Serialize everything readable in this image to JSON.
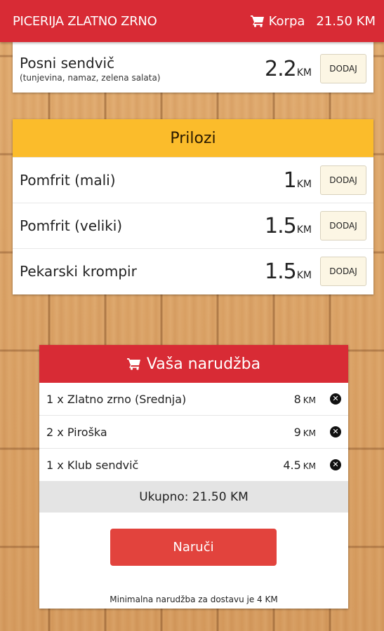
{
  "header": {
    "brand": "PICERIJA ZLATNO ZRNO",
    "cart_icon": "cart-icon",
    "cart_label": "Korpa",
    "cart_total": "21.50 KM",
    "color": "#d82b35"
  },
  "partial_item": {
    "name": "Posni sendvič",
    "description": "(tunjevina, namaz, zelena salata)",
    "price": "2.2",
    "currency": "KM",
    "add_label": "DODAJ"
  },
  "prilozi": {
    "title": "Prilozi",
    "color": "#fbbc2b",
    "items": [
      {
        "name": "Pomfrit (mali)",
        "price": "1",
        "currency": "KM",
        "add_label": "DODAJ"
      },
      {
        "name": "Pomfrit (veliki)",
        "price": "1.5",
        "currency": "KM",
        "add_label": "DODAJ"
      },
      {
        "name": "Pekarski krompir",
        "price": "1.5",
        "currency": "KM",
        "add_label": "DODAJ"
      }
    ]
  },
  "order": {
    "title": "Vaša narudžba",
    "cart_icon": "cart-icon",
    "items": [
      {
        "text": "1 x Zlatno zrno (Srednja)",
        "price": "8",
        "currency": "KM",
        "remove_icon": "close-icon"
      },
      {
        "text": "2 x Piroška",
        "price": "9",
        "currency": "KM",
        "remove_icon": "close-icon"
      },
      {
        "text": "1 x Klub sendvič",
        "price": "4.5",
        "currency": "KM",
        "remove_icon": "close-icon"
      }
    ],
    "total_label": "Ukupno: 21.50 KM",
    "order_button": "Naruči",
    "min_note": "Minimalna narudžba za dostavu je 4 KM",
    "button_color": "#e2433d"
  }
}
